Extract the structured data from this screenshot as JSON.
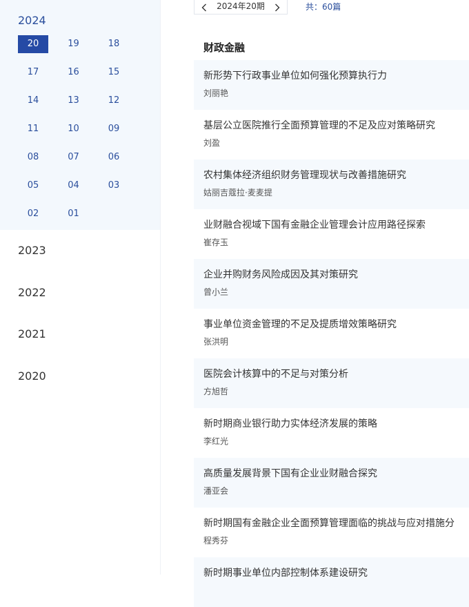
{
  "sidebar": {
    "current_year": "2024",
    "issues": [
      "20",
      "19",
      "18",
      "17",
      "16",
      "15",
      "14",
      "13",
      "12",
      "11",
      "10",
      "09",
      "08",
      "07",
      "06",
      "05",
      "04",
      "03",
      "02",
      "01"
    ],
    "active_issue": "20",
    "other_years": [
      "2023",
      "2022",
      "2021",
      "2020"
    ]
  },
  "nav": {
    "current_issue": "2024年20期",
    "total": "共：60篇"
  },
  "section": {
    "title": "财政金融"
  },
  "articles": [
    {
      "title": "新形势下行政事业单位如何强化预算执行力",
      "author": "刘丽艳"
    },
    {
      "title": "基层公立医院推行全面预算管理的不足及应对策略研究",
      "author": "刘盈"
    },
    {
      "title": "农村集体经济组织财务管理现状与改善措施研究",
      "author": "姑丽吉蔻拉·麦麦提"
    },
    {
      "title": "业财融合视域下国有金融企业管理会计应用路径探索",
      "author": "崔存玉"
    },
    {
      "title": "企业并购财务风险成因及其对策研究",
      "author": "曾小兰"
    },
    {
      "title": "事业单位资金管理的不足及提质增效策略研究",
      "author": "张洪明"
    },
    {
      "title": "医院会计核算中的不足与对策分析",
      "author": "方旭哲"
    },
    {
      "title": "新时期商业银行助力实体经济发展的策略",
      "author": "李红光"
    },
    {
      "title": "高质量发展背景下国有企业业财融合探究",
      "author": "潘亚会"
    },
    {
      "title": "新时期国有金融企业全面预算管理面临的挑战与应对措施分",
      "author": "程秀芬"
    },
    {
      "title": "新时期事业单位内部控制体系建设研究",
      "author": ""
    }
  ],
  "colors": {
    "accent": "#254aa5",
    "link_blue": "#2a4e9c",
    "shade": "#f5f9fd"
  }
}
